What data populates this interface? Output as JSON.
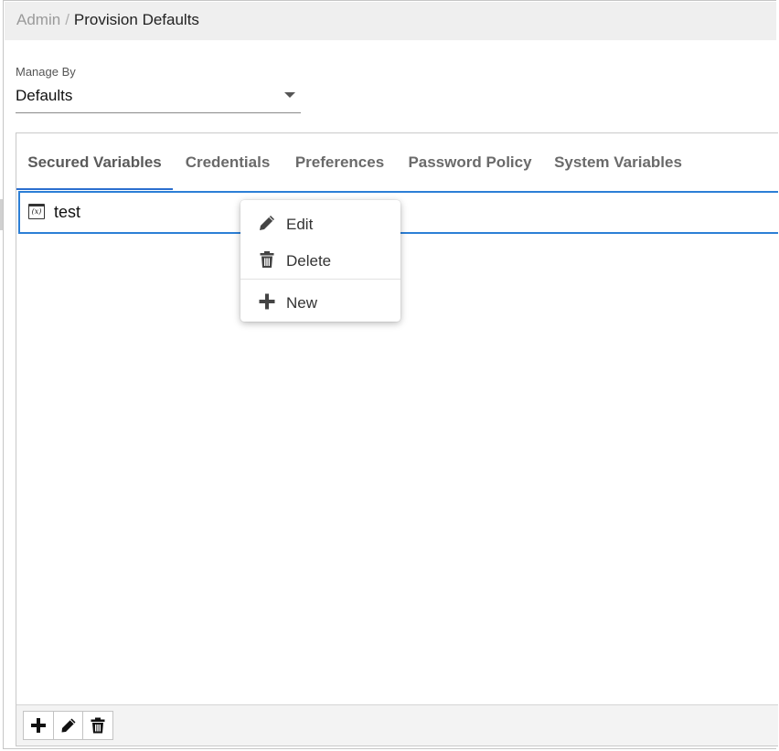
{
  "breadcrumb": {
    "root": "Admin",
    "separator": "/",
    "current": "Provision Defaults"
  },
  "manage_by": {
    "label": "Manage By",
    "value": "Defaults"
  },
  "tabs": [
    {
      "label": "Secured Variables",
      "active": true
    },
    {
      "label": "Credentials",
      "active": false
    },
    {
      "label": "Preferences",
      "active": false
    },
    {
      "label": "Password Policy",
      "active": false
    },
    {
      "label": "System Variables",
      "active": false
    }
  ],
  "list": {
    "items": [
      {
        "label": "test",
        "icon": "variable-icon",
        "selected": true
      }
    ]
  },
  "context_menu": {
    "items": [
      {
        "label": "Edit",
        "icon": "pencil-icon"
      },
      {
        "label": "Delete",
        "icon": "trash-icon"
      },
      {
        "label": "New",
        "icon": "plus-icon"
      }
    ]
  },
  "toolbar": {
    "buttons": [
      {
        "icon": "plus-icon"
      },
      {
        "icon": "pencil-icon"
      },
      {
        "icon": "trash-icon"
      }
    ]
  },
  "colors": {
    "accent": "#2c7fd6",
    "header_bg": "#efefef",
    "tab_text": "#6a6a6a"
  }
}
